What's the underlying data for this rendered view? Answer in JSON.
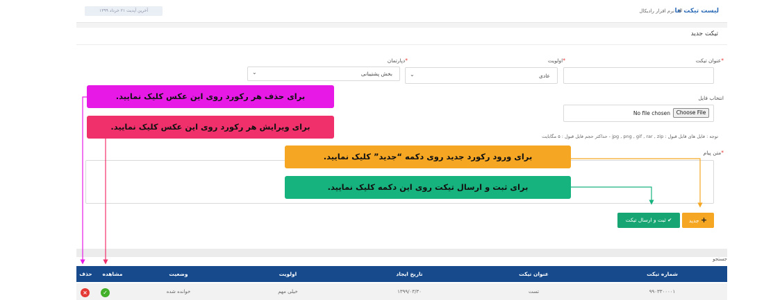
{
  "header": {
    "title": "لیست تیکت ها",
    "separator": "#",
    "subtitle": "نرم افزار رادیکال",
    "update_badge": "آخرین آپدیت ۲۱ خرداد ۱۳۹۹"
  },
  "form": {
    "section_title": "تیکت جدید",
    "subject_label": "عنوان تیکت",
    "priority_label": "اولویت",
    "priority_value": "عادی",
    "department_label": "دپارتمان",
    "department_value": "بخش پشتیبانی",
    "required_mark": "*",
    "file_label": "انتخاب فایل",
    "file_button": "Choose File",
    "file_status": "No file chosen",
    "file_note": "توجه : فایل های قابل قبول : jpg , png , gif , rar , zip - حداکثر حجم فایل قبول : ۵ مگابایت",
    "message_label": "متن پیام"
  },
  "buttons": {
    "submit_label": "ثبت و ارسال تیکت",
    "new_label": "جدید"
  },
  "search": {
    "label": "جستجو"
  },
  "table": {
    "columns": [
      "شماره تیکت",
      "عنوان تیکت",
      "تاریخ ایجاد",
      "اولویت",
      "وضعیت",
      "مشاهده",
      "حذف"
    ],
    "rows": [
      {
        "ticket_no": "۹۹۰۳۳۰۰۰۰۱",
        "subject": "تست",
        "created": "۱۳۹۹/۰۳/۳۰",
        "priority": "خیلی مهم",
        "status": "خوانده شده"
      }
    ]
  },
  "annotations": {
    "delete_hint": "برای حذف هر رکورد روی این عکس کلیک نمایید.",
    "edit_hint": "برای ویرایش هر رکورد روی این عکس کلیک نمایید.",
    "new_hint": "برای ورود رکورد جدید روی دکمه “جدید” کلیک نمایید.",
    "submit_hint": "برای ثبت و ارسال تیکت روی این دکمه کلیک نمایید."
  },
  "colors": {
    "delete_hint": "#e619e6",
    "edit_hint": "#f0306a",
    "new_hint": "#f5a623",
    "submit_hint": "#17b37f",
    "table_header": "#164a8c",
    "view_icon": "#43b02a",
    "delete_icon": "#e53935"
  }
}
